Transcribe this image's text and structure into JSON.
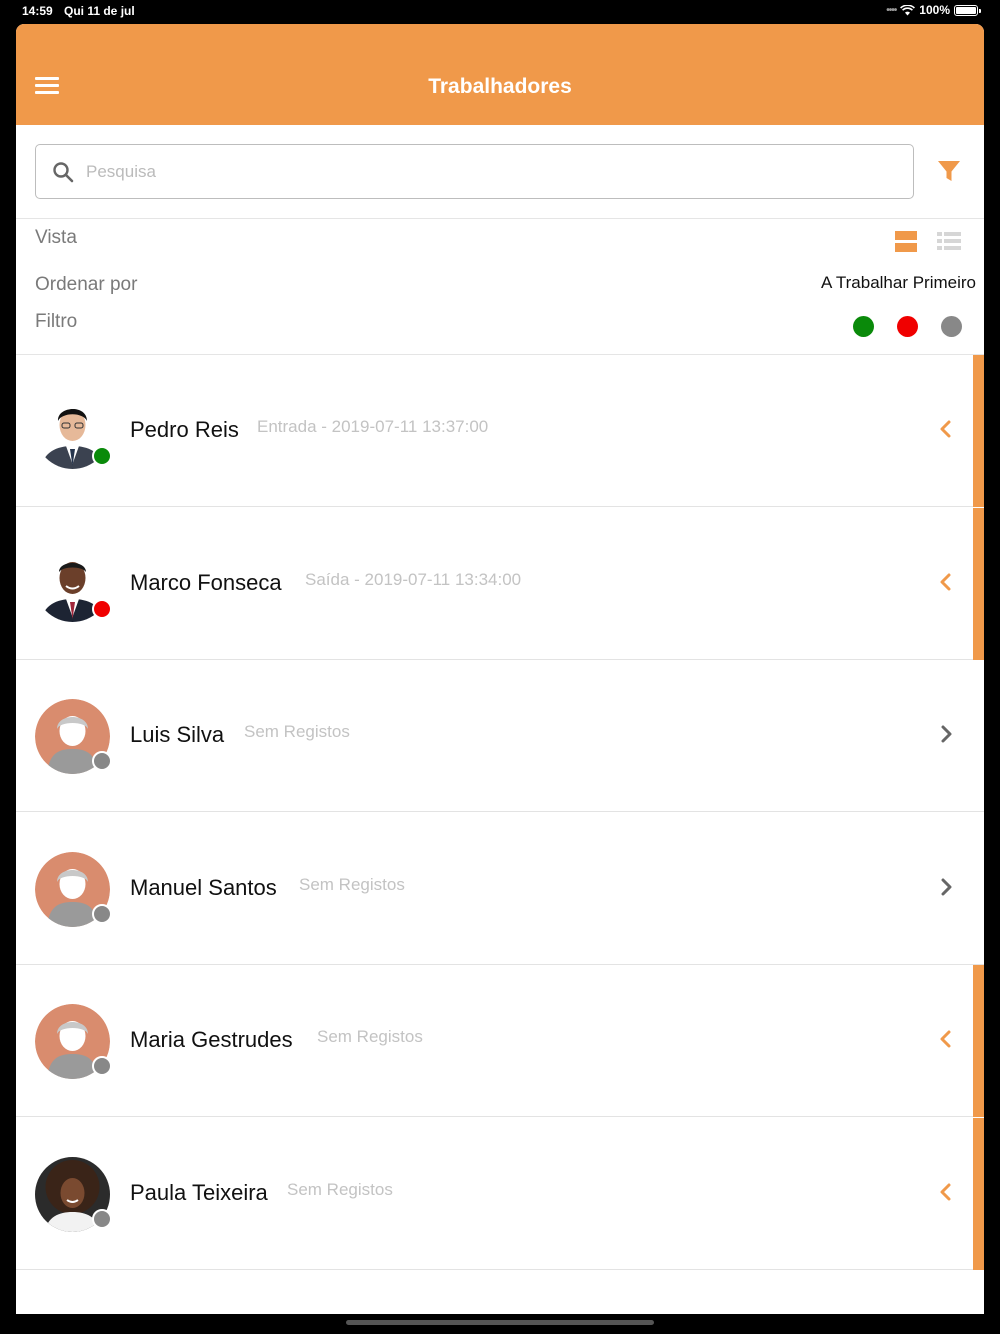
{
  "status_bar": {
    "time": "14:59",
    "date": "Qui 11 de jul",
    "battery": "100%"
  },
  "header": {
    "title": "Trabalhadores"
  },
  "search": {
    "placeholder": "Pesquisa"
  },
  "options": {
    "view_label": "Vista",
    "sort_label": "Ordenar por",
    "sort_value": "A Trabalhar Primeiro",
    "filter_label": "Filtro",
    "filter_colors": [
      "#0a8a0a",
      "#f00000",
      "#888888"
    ]
  },
  "colors": {
    "accent": "#f0994a",
    "working": "#0a8a0a",
    "left": "#f00000",
    "none": "#888888"
  },
  "workers": [
    {
      "name": "Pedro Reis",
      "info": "Entrada - 2019-07-11 13:37:00",
      "status": "working",
      "avatar": "photo-man-asian",
      "expanded": true
    },
    {
      "name": "Marco Fonseca",
      "info": "Saída - 2019-07-11 13:34:00",
      "status": "left",
      "avatar": "photo-man-dark",
      "expanded": true
    },
    {
      "name": "Luis Silva",
      "info": "Sem Registos",
      "status": "none",
      "avatar": "placeholder",
      "expanded": false
    },
    {
      "name": "Manuel Santos",
      "info": "Sem Registos",
      "status": "none",
      "avatar": "placeholder",
      "expanded": false
    },
    {
      "name": "Maria Gestrudes",
      "info": "Sem Registos",
      "status": "none",
      "avatar": "placeholder",
      "expanded": true
    },
    {
      "name": "Paula Teixeira",
      "info": "Sem Registos",
      "status": "none",
      "avatar": "photo-woman",
      "expanded": true
    }
  ]
}
